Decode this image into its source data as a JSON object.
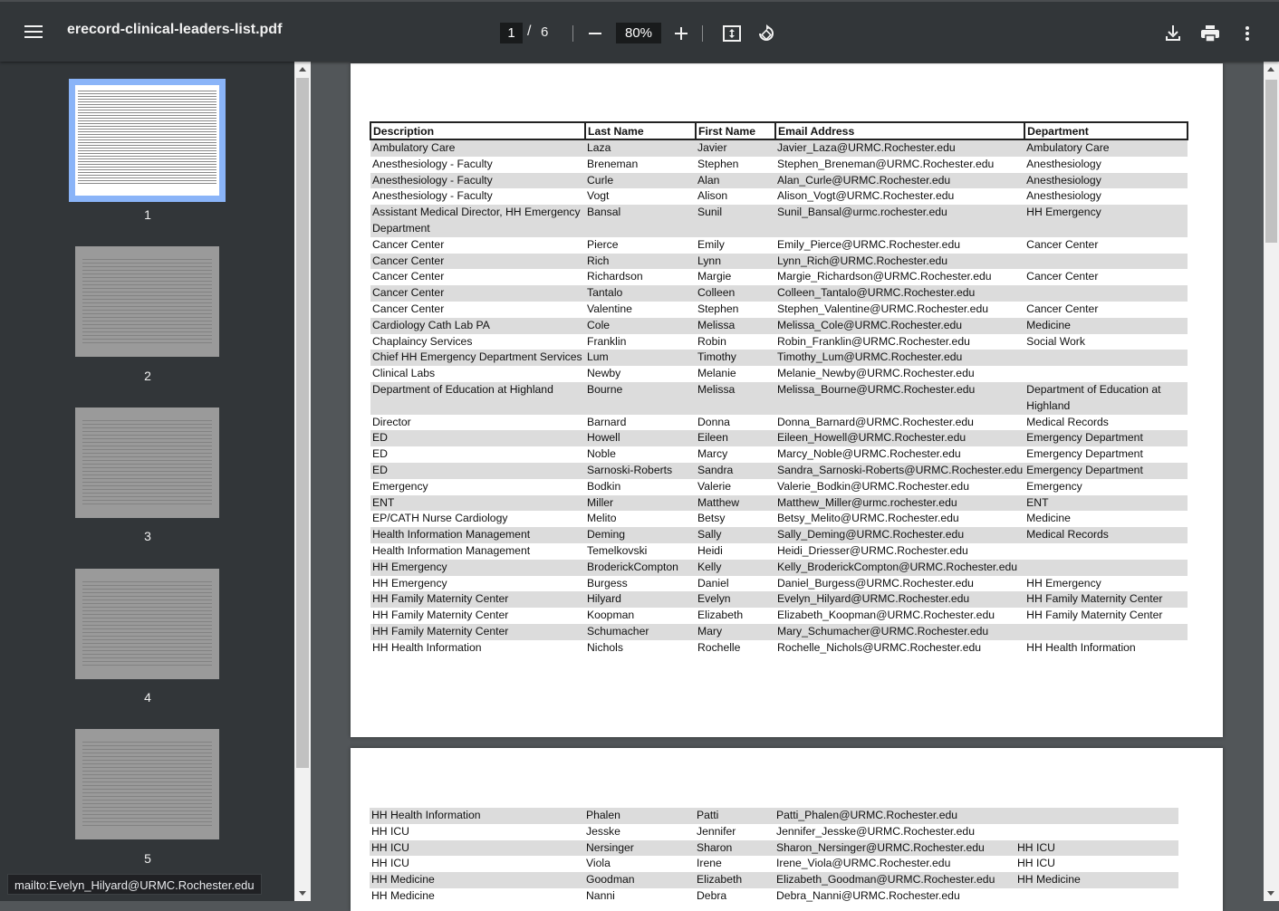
{
  "toolbar": {
    "title": "erecord-clinical-leaders-list.pdf",
    "current_page": "1",
    "page_sep": "/",
    "total_pages": "6",
    "zoom": "80%"
  },
  "thumbnails": [
    {
      "label": "1"
    },
    {
      "label": "2"
    },
    {
      "label": "3"
    },
    {
      "label": "4"
    },
    {
      "label": "5"
    }
  ],
  "table": {
    "headers": [
      "Description",
      "Last Name",
      "First Name",
      "Email Address",
      "Department"
    ]
  },
  "page1_rows": [
    [
      "Ambulatory Care",
      "Laza",
      "Javier",
      "Javier_Laza@URMC.Rochester.edu",
      "Ambulatory Care"
    ],
    [
      "Anesthesiology - Faculty",
      "Breneman",
      "Stephen",
      "Stephen_Breneman@URMC.Rochester.edu",
      "Anesthesiology"
    ],
    [
      "Anesthesiology - Faculty",
      "Curle",
      "Alan",
      "Alan_Curle@URMC.Rochester.edu",
      "Anesthesiology"
    ],
    [
      "Anesthesiology - Faculty",
      "Vogt",
      "Alison",
      "Alison_Vogt@URMC.Rochester.edu",
      "Anesthesiology"
    ],
    [
      "Assistant Medical Director, HH Emergency Department",
      "Bansal",
      "Sunil",
      "Sunil_Bansal@urmc.rochester.edu",
      "HH Emergency"
    ],
    [
      "Cancer Center",
      "Pierce",
      "Emily",
      "Emily_Pierce@URMC.Rochester.edu",
      "Cancer Center"
    ],
    [
      "Cancer Center",
      "Rich",
      "Lynn",
      "Lynn_Rich@URMC.Rochester.edu",
      ""
    ],
    [
      "Cancer Center",
      "Richardson",
      "Margie",
      "Margie_Richardson@URMC.Rochester.edu",
      "Cancer Center"
    ],
    [
      "Cancer Center",
      "Tantalo",
      "Colleen",
      "Colleen_Tantalo@URMC.Rochester.edu",
      ""
    ],
    [
      "Cancer Center",
      "Valentine",
      "Stephen",
      "Stephen_Valentine@URMC.Rochester.edu",
      "Cancer Center"
    ],
    [
      "Cardiology Cath Lab PA",
      "Cole",
      "Melissa",
      "Melissa_Cole@URMC.Rochester.edu",
      "Medicine"
    ],
    [
      "Chaplaincy Services",
      "Franklin",
      "Robin",
      "Robin_Franklin@URMC.Rochester.edu",
      "Social Work"
    ],
    [
      "Chief HH Emergency Department Services",
      "Lum",
      "Timothy",
      "Timothy_Lum@URMC.Rochester.edu",
      ""
    ],
    [
      "Clinical Labs",
      "Newby",
      "Melanie",
      "Melanie_Newby@URMC.Rochester.edu",
      ""
    ],
    [
      "Department of Education at Highland",
      "Bourne",
      "Melissa",
      "Melissa_Bourne@URMC.Rochester.edu",
      "Department of Education at Highland"
    ],
    [
      "Director",
      "Barnard",
      "Donna",
      "Donna_Barnard@URMC.Rochester.edu",
      "Medical Records"
    ],
    [
      "ED",
      "Howell",
      "Eileen",
      "Eileen_Howell@URMC.Rochester.edu",
      "Emergency Department"
    ],
    [
      "ED",
      "Noble",
      "Marcy",
      "Marcy_Noble@URMC.Rochester.edu",
      "Emergency Department"
    ],
    [
      "ED",
      "Sarnoski-Roberts",
      "Sandra",
      "Sandra_Sarnoski-Roberts@URMC.Rochester.edu",
      "Emergency Department"
    ],
    [
      "Emergency",
      "Bodkin",
      "Valerie",
      "Valerie_Bodkin@URMC.Rochester.edu",
      "Emergency"
    ],
    [
      "ENT",
      "Miller",
      "Matthew",
      "Matthew_Miller@urmc.rochester.edu",
      "ENT"
    ],
    [
      "EP/CATH Nurse Cardiology",
      "Melito",
      "Betsy",
      "Betsy_Melito@URMC.Rochester.edu",
      "Medicine"
    ],
    [
      "Health Information Management",
      "Deming",
      "Sally",
      "Sally_Deming@URMC.Rochester.edu",
      "Medical Records"
    ],
    [
      "Health Information Management",
      "Temelkovski",
      "Heidi",
      "Heidi_Driesser@URMC.Rochester.edu",
      ""
    ],
    [
      "HH Emergency",
      "BroderickCompton",
      "Kelly",
      "Kelly_BroderickCompton@URMC.Rochester.edu",
      ""
    ],
    [
      "HH Emergency",
      "Burgess",
      "Daniel",
      "Daniel_Burgess@URMC.Rochester.edu",
      "HH Emergency"
    ],
    [
      "HH Family Maternity Center",
      "Hilyard",
      "Evelyn",
      "Evelyn_Hilyard@URMC.Rochester.edu",
      "HH Family Maternity Center"
    ],
    [
      "HH Family Maternity Center",
      "Koopman",
      "Elizabeth",
      "Elizabeth_Koopman@URMC.Rochester.edu",
      "HH Family Maternity Center"
    ],
    [
      "HH Family Maternity Center",
      "Schumacher",
      "Mary",
      "Mary_Schumacher@URMC.Rochester.edu",
      ""
    ],
    [
      "HH Health Information",
      "Nichols",
      "Rochelle",
      "Rochelle_Nichols@URMC.Rochester.edu",
      "HH Health Information"
    ]
  ],
  "page2_rows": [
    [
      "HH Health Information",
      "Phalen",
      "Patti",
      "Patti_Phalen@URMC.Rochester.edu",
      ""
    ],
    [
      "HH ICU",
      "Jesske",
      "Jennifer",
      "Jennifer_Jesske@URMC.Rochester.edu",
      ""
    ],
    [
      "HH ICU",
      "Nersinger",
      "Sharon",
      "Sharon_Nersinger@URMC.Rochester.edu",
      "HH ICU"
    ],
    [
      "HH ICU",
      "Viola",
      "Irene",
      "Irene_Viola@URMC.Rochester.edu",
      "HH ICU"
    ],
    [
      "HH Medicine",
      "Goodman",
      "Elizabeth",
      "Elizabeth_Goodman@URMC.Rochester.edu",
      "HH Medicine"
    ],
    [
      "HH Medicine",
      "Nanni",
      "Debra",
      "Debra_Nanni@URMC.Rochester.edu",
      ""
    ]
  ],
  "status_bar": "mailto:Evelyn_Hilyard@URMC.Rochester.edu"
}
